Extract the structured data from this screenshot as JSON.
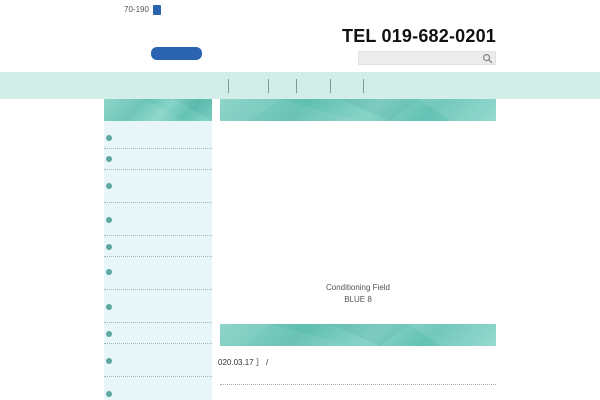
{
  "header": {
    "postal": "70-190",
    "tel": "TEL 019-682-0201",
    "search_placeholder": ""
  },
  "nav": {
    "items": [
      "",
      "",
      "",
      ""
    ]
  },
  "sidebar": {
    "items": [
      "",
      "",
      "",
      "",
      "",
      "",
      "",
      "",
      "",
      "",
      ""
    ]
  },
  "main": {
    "caption_line1": "Conditioning Field",
    "caption_line2": "BLUE 8",
    "news_text": "020.03.17 ］ /"
  },
  "icons": {
    "search": "search-icon",
    "bullet": "chevron-right-icon"
  },
  "colors": {
    "brand_blue": "#2a63b0",
    "nav_bg": "#d3ede8",
    "sidebar_bg": "#e8f5f9",
    "teal": "#63c2b4"
  }
}
